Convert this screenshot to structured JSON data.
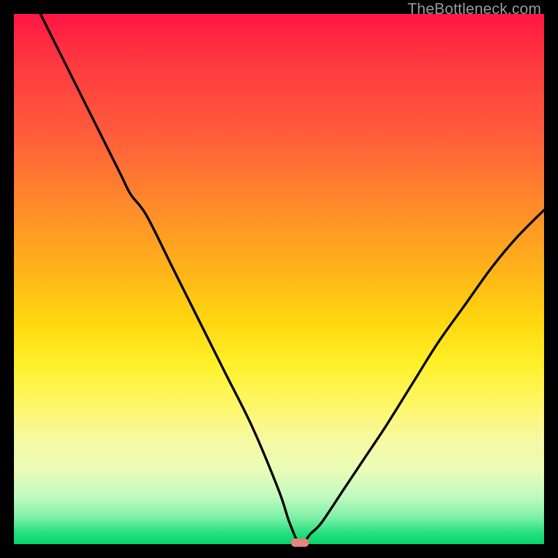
{
  "watermark": {
    "text": "TheBottleneck.com"
  },
  "colors": {
    "frame_bg": "#000000",
    "curve_stroke": "#000000",
    "marker_fill": "#e5857e",
    "gradient_stops": [
      {
        "pct": 0,
        "hex": "#ff1744"
      },
      {
        "pct": 10,
        "hex": "#ff3b3f"
      },
      {
        "pct": 22,
        "hex": "#ff5a3c"
      },
      {
        "pct": 36,
        "hex": "#ff8a2b"
      },
      {
        "pct": 48,
        "hex": "#ffb21a"
      },
      {
        "pct": 58,
        "hex": "#ffd70f"
      },
      {
        "pct": 66,
        "hex": "#fff029"
      },
      {
        "pct": 74,
        "hex": "#fdf76a"
      },
      {
        "pct": 80,
        "hex": "#f7f9a0"
      },
      {
        "pct": 86,
        "hex": "#eafcb8"
      },
      {
        "pct": 91,
        "hex": "#c1fac0"
      },
      {
        "pct": 95,
        "hex": "#7ef0a6"
      },
      {
        "pct": 98,
        "hex": "#22e07c"
      },
      {
        "pct": 100,
        "hex": "#08d66a"
      }
    ]
  },
  "chart_data": {
    "type": "line",
    "title": "",
    "xlabel": "",
    "ylabel": "",
    "xlim": [
      0,
      100
    ],
    "ylim": [
      0,
      100
    ],
    "note": "Bottleneck-style V curve. Values estimated from pixels: y=0 at bottom (optimal), y=100 at top (worst).",
    "optimum_x": 54,
    "marker": {
      "x": 54,
      "y": 0,
      "shape": "pill"
    },
    "series": [
      {
        "name": "bottleneck-curve",
        "x": [
          5,
          10,
          15,
          20,
          22,
          25,
          30,
          35,
          40,
          45,
          50,
          52,
          54,
          56,
          58,
          62,
          66,
          70,
          75,
          80,
          85,
          90,
          95,
          100
        ],
        "y": [
          100,
          90,
          80,
          70,
          66,
          62,
          52,
          42,
          32,
          22,
          10,
          4,
          0,
          2,
          4,
          10,
          16,
          22,
          30,
          38,
          45,
          52,
          58,
          63
        ]
      }
    ]
  }
}
